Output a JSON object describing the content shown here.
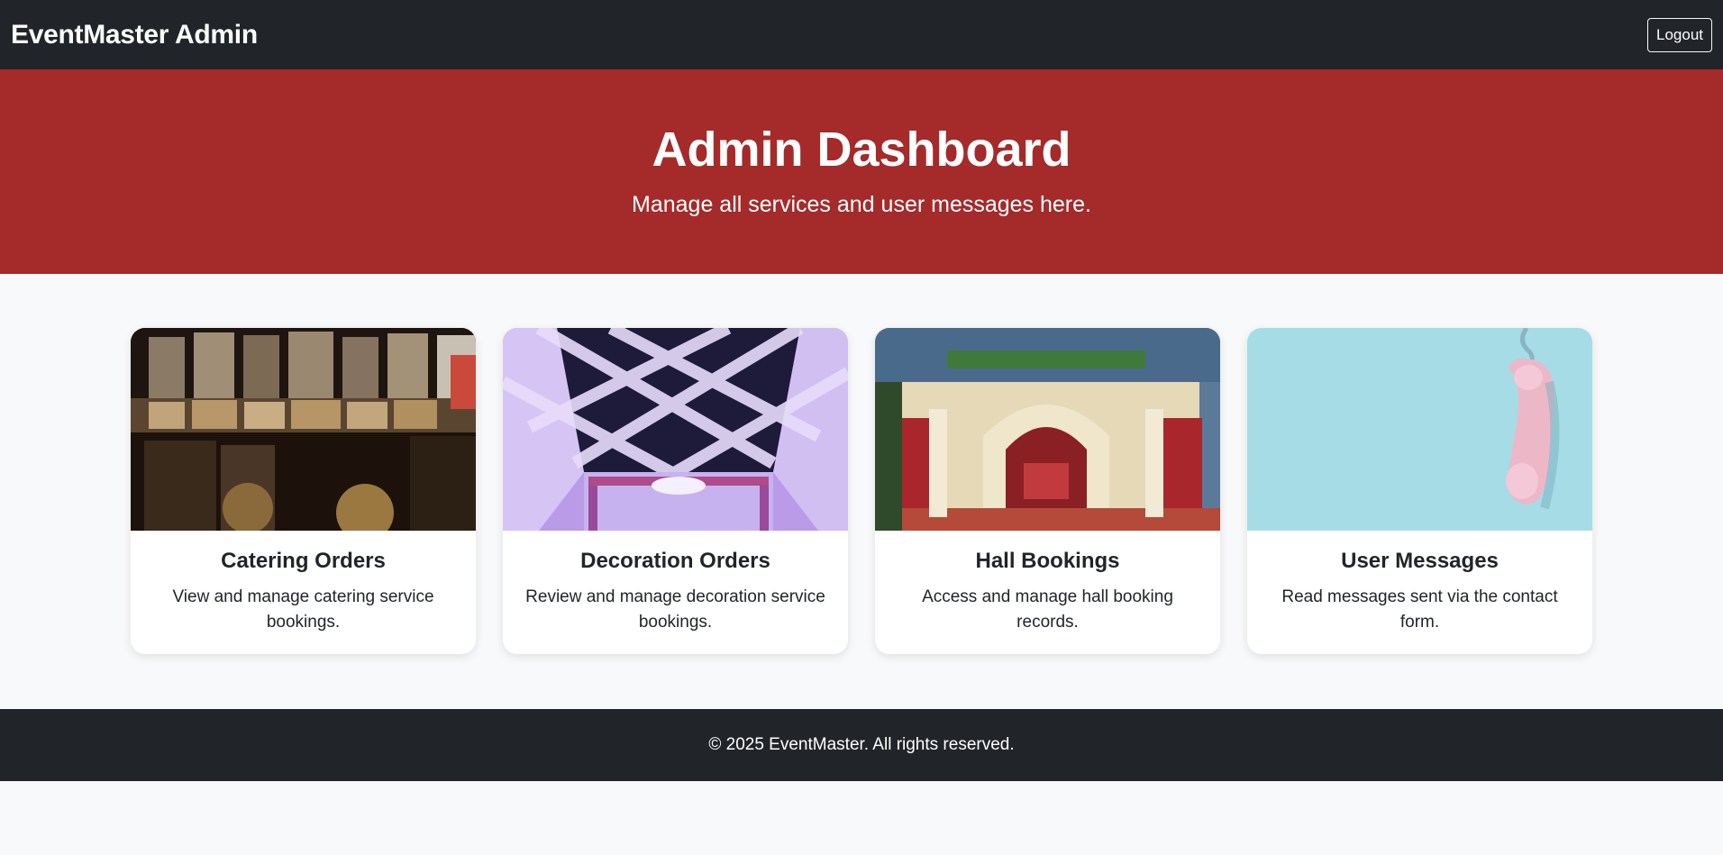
{
  "navbar": {
    "brand": "EventMaster Admin",
    "logout_label": "Logout"
  },
  "hero": {
    "title": "Admin Dashboard",
    "subtitle": "Manage all services and user messages here."
  },
  "cards": [
    {
      "title": "Catering Orders",
      "description": "View and manage catering service bookings.",
      "image": "catering-buffet-photo"
    },
    {
      "title": "Decoration Orders",
      "description": "Review and manage decoration service bookings.",
      "image": "draped-ceiling-decoration-photo"
    },
    {
      "title": "Hall Bookings",
      "description": "Access and manage hall booking records.",
      "image": "wedding-hall-stage-photo"
    },
    {
      "title": "User Messages",
      "description": "Read messages sent via the contact form.",
      "image": "pink-telephone-receiver-photo"
    }
  ],
  "footer": {
    "text": "© 2025 EventMaster. All rights reserved."
  },
  "colors": {
    "navbar_bg": "#212529",
    "hero_bg": "#a52a2a",
    "page_bg": "#f8f9fa",
    "card_bg": "#ffffff"
  }
}
